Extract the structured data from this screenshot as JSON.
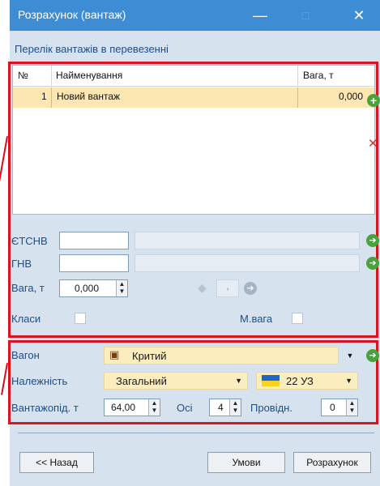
{
  "window": {
    "title": "Розрахунок (вантаж)"
  },
  "title_buttons": {
    "minimize": "—",
    "maximize": "□",
    "close": "✕"
  },
  "section_title": "Перелік вантажів в перевезенні",
  "cargo_table": {
    "columns": [
      "№",
      "Найменування",
      "Вага, т"
    ],
    "rows": [
      {
        "num": "1",
        "name": "Новий вантаж",
        "weight": "0,000"
      }
    ]
  },
  "fields": {
    "etsnv_label": "ЄТСНВ",
    "gnv_label": "ГНВ",
    "weight_label": "Вага, т",
    "weight_value": "0,000",
    "small_value": ",",
    "classes_label": "Класи",
    "mweight_label": "М.вага"
  },
  "wagon": {
    "wagon_label": "Вагон",
    "wagon_value": "Критий",
    "belonging_label": "Належність",
    "belonging_value": "Загальний",
    "railway_value": "22 УЗ",
    "capacity_label": "Вантажопід. т",
    "capacity_value": "64,00",
    "axles_label": "Осі",
    "axles_value": "4",
    "conductors_label": "Провідн.",
    "conductors_value": "0"
  },
  "buttons": {
    "back": "<< Назад",
    "conditions": "Умови",
    "calculate": "Розрахунок"
  },
  "colors": {
    "titlebar": "#3e8dd4",
    "accent_red": "#d9141e",
    "row_highlight": "#fce6b2",
    "panel": "#d6e3ef"
  }
}
